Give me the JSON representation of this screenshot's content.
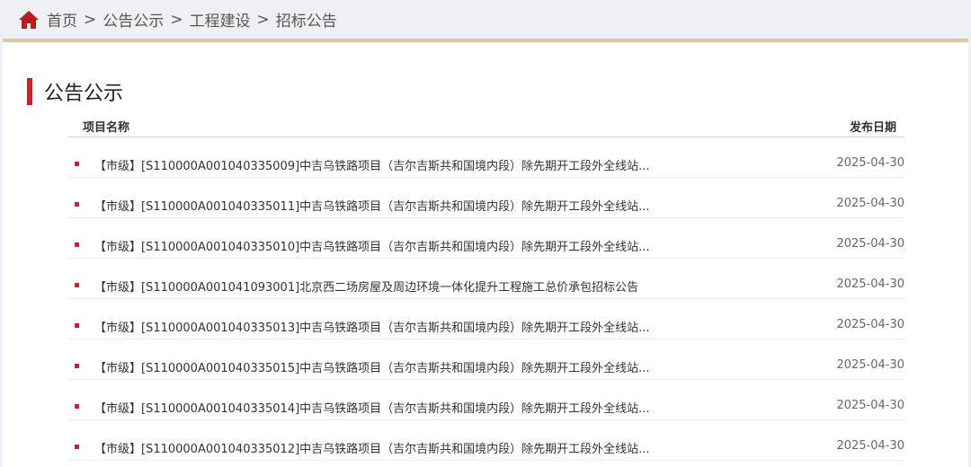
{
  "breadcrumb": {
    "home_icon": "home-icon",
    "items": [
      "首页",
      "公告公示",
      "工程建设",
      "招标公告"
    ],
    "separator": ">"
  },
  "section": {
    "title": "公告公示"
  },
  "table": {
    "headers": {
      "name": "项目名称",
      "date": "发布日期"
    },
    "rows": [
      {
        "title": "【市级】[S110000A001040335009]中吉乌铁路项目（吉尔吉斯共和国境内段）除先期开工段外全线站...",
        "date": "2025-04-30"
      },
      {
        "title": "【市级】[S110000A001040335011]中吉乌铁路项目（吉尔吉斯共和国境内段）除先期开工段外全线站...",
        "date": "2025-04-30"
      },
      {
        "title": "【市级】[S110000A001040335010]中吉乌铁路项目（吉尔吉斯共和国境内段）除先期开工段外全线站...",
        "date": "2025-04-30"
      },
      {
        "title": "【市级】[S110000A001041093001]北京西二场房屋及周边环境一体化提升工程施工总价承包招标公告",
        "date": "2025-04-30"
      },
      {
        "title": "【市级】[S110000A001040335013]中吉乌铁路项目（吉尔吉斯共和国境内段）除先期开工段外全线站...",
        "date": "2025-04-30"
      },
      {
        "title": "【市级】[S110000A001040335015]中吉乌铁路项目（吉尔吉斯共和国境内段）除先期开工段外全线站...",
        "date": "2025-04-30"
      },
      {
        "title": "【市级】[S110000A001040335014]中吉乌铁路项目（吉尔吉斯共和国境内段）除先期开工段外全线站...",
        "date": "2025-04-30"
      },
      {
        "title": "【市级】[S110000A001040335012]中吉乌铁路项目（吉尔吉斯共和国境内段）除先期开工段外全线站...",
        "date": "2025-04-30"
      }
    ]
  },
  "colors": {
    "accent": "#cc1f27",
    "divider": "#dcc9a6"
  }
}
